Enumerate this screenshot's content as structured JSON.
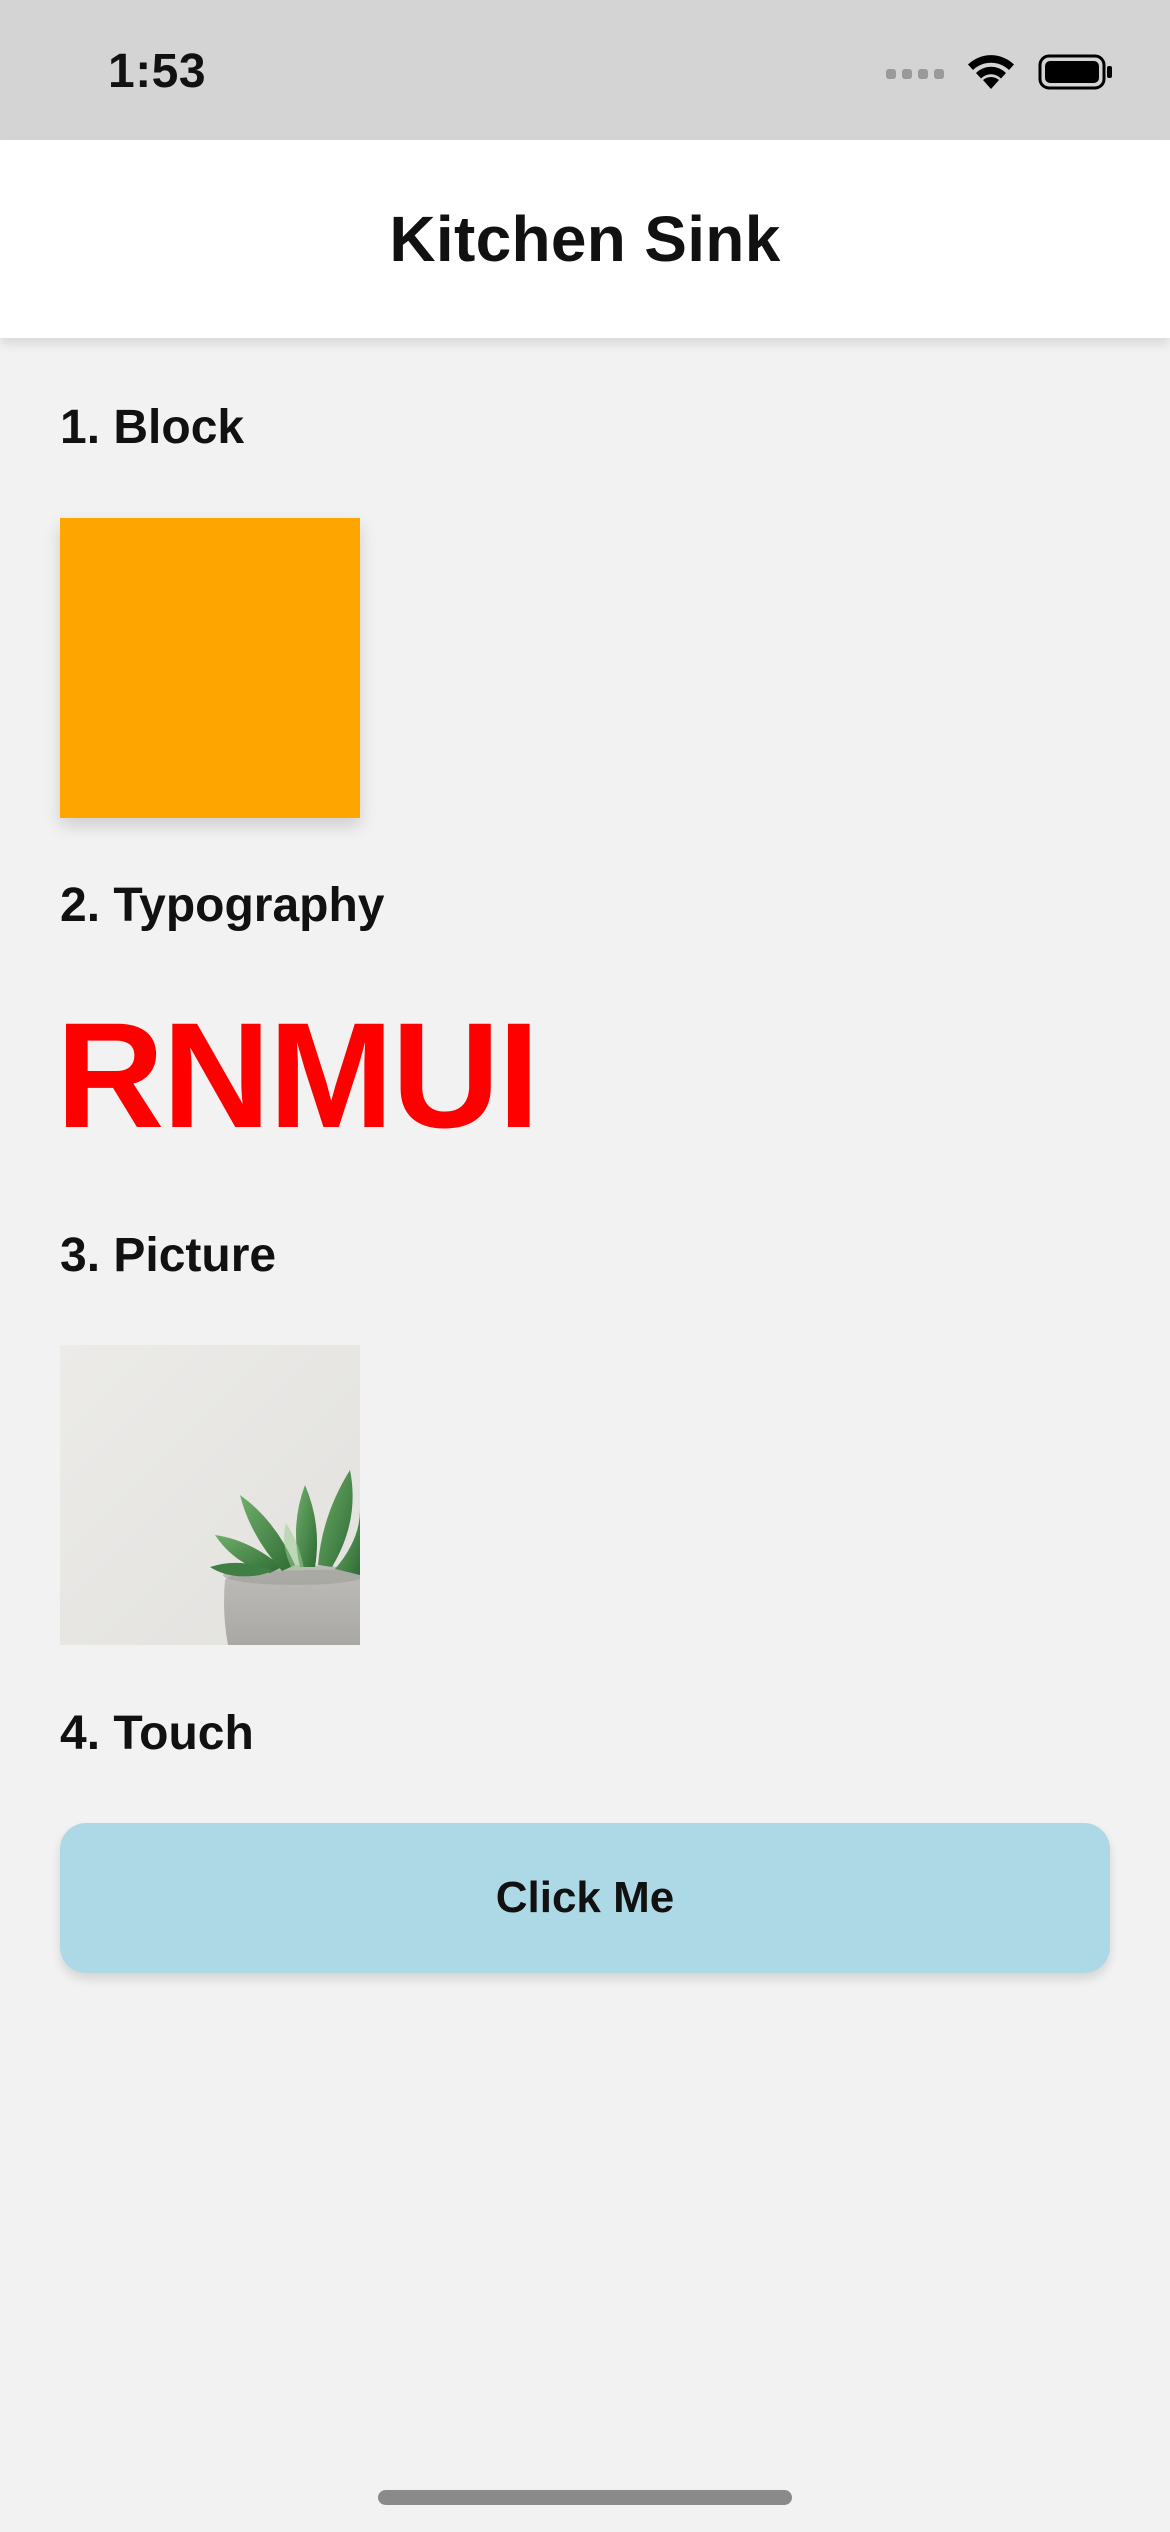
{
  "status_bar": {
    "time": "1:53",
    "icons": [
      "signal-icon",
      "wifi-icon",
      "battery-icon"
    ]
  },
  "header": {
    "title": "Kitchen Sink"
  },
  "sections": [
    {
      "label": "1. Block"
    },
    {
      "label": "2. Typography"
    },
    {
      "label": "3. Picture"
    },
    {
      "label": "4. Touch"
    }
  ],
  "block": {
    "color": "#ffa500"
  },
  "typography": {
    "sample_text": "RNMUI",
    "color": "#ff0000"
  },
  "picture": {
    "subject": "potted-succulent"
  },
  "touch": {
    "button_label": "Click Me",
    "button_color": "#add8e6"
  },
  "colors": {
    "background": "#f2f2f2",
    "status_bar": "#d4d4d4",
    "header": "#ffffff"
  }
}
